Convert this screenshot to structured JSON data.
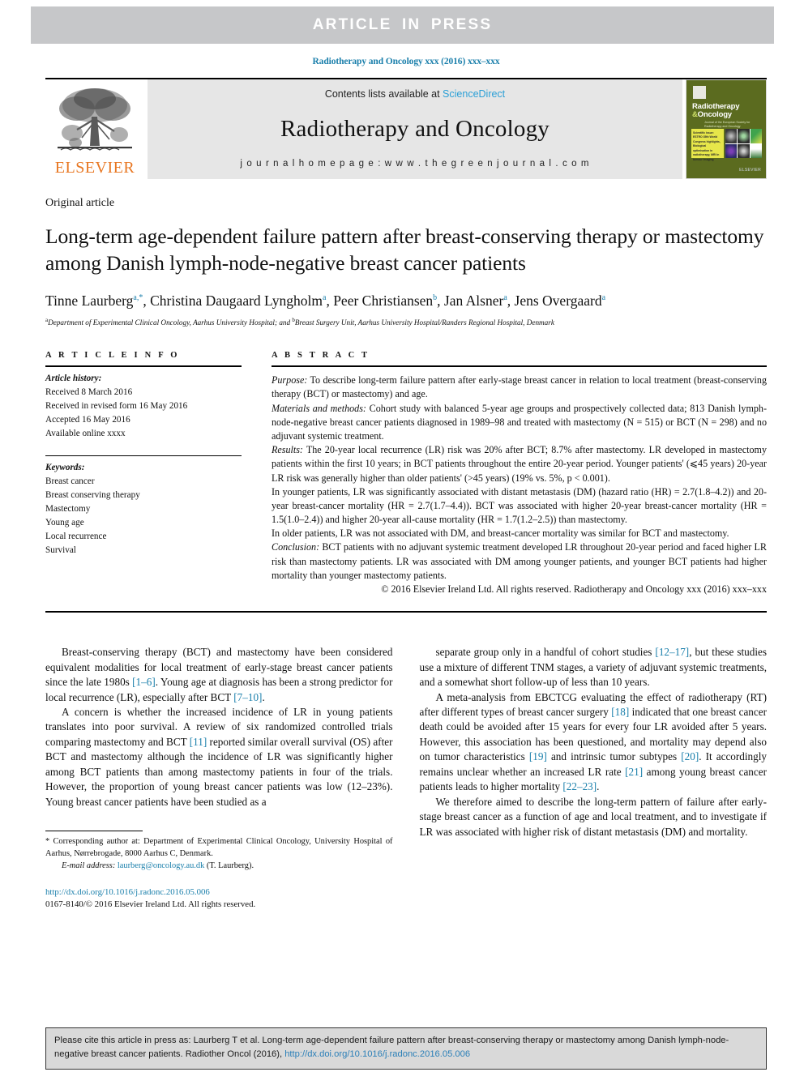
{
  "banner": {
    "text": "ARTICLE  IN  PRESS"
  },
  "journal_ref_top": "Radiotherapy and Oncology xxx (2016) xxx–xxx",
  "masthead": {
    "contents_prefix": "Contents lists available at ",
    "sciencedirect": "ScienceDirect",
    "journal_title": "Radiotherapy and Oncology",
    "homepage": "j o u r n a l   h o m e p a g e :   w w w . t h e g r e e n j o u r n a l . c o m",
    "publisher_word": "ELSEVIER",
    "cover": {
      "title_line1": "Radiotherapy",
      "title_amp": "&",
      "title_line2": "Oncology",
      "subtitle": "Journal of the European Society for Radiotherapy and Oncology",
      "yellow_note": "Scientific issue: ESTRO 35th World Congress highlights, Biological optimisation in radiotherapy, MRI in tumour imaging",
      "logo": "ELSEVIER"
    }
  },
  "article": {
    "type": "Original article",
    "title": "Long-term age-dependent failure pattern after breast-conserving therapy or mastectomy among Danish lymph-node-negative breast cancer patients",
    "authors": [
      {
        "name": "Tinne Laurberg",
        "sup": "a,*"
      },
      {
        "name": "Christina Daugaard Lyngholm",
        "sup": "a"
      },
      {
        "name": "Peer Christiansen",
        "sup": "b"
      },
      {
        "name": "Jan Alsner",
        "sup": "a"
      },
      {
        "name": "Jens Overgaard",
        "sup": "a"
      }
    ],
    "affiliation_a": "Department of Experimental Clinical Oncology, Aarhus University Hospital; and ",
    "affiliation_b": "Breast Surgery Unit, Aarhus University Hospital/Randers Regional Hospital, Denmark"
  },
  "info": {
    "heading": "A R T I C L E   I N F O",
    "history_label": "Article history:",
    "history": [
      "Received 8 March 2016",
      "Received in revised form 16 May 2016",
      "Accepted 16 May 2016",
      "Available online xxxx"
    ],
    "keywords_label": "Keywords:",
    "keywords": [
      "Breast cancer",
      "Breast conserving therapy",
      "Mastectomy",
      "Young age",
      "Local recurrence",
      "Survival"
    ]
  },
  "abstract": {
    "heading": "A B S T R A C T",
    "purpose_label": "Purpose:",
    "purpose_text": " To describe long-term failure pattern after early-stage breast cancer in relation to local treatment (breast-conserving therapy (BCT) or mastectomy) and age.",
    "methods_label": "Materials and methods:",
    "methods_text": " Cohort study with balanced 5-year age groups and prospectively collected data; 813 Danish lymph-node-negative breast cancer patients diagnosed in 1989–98 and treated with mastectomy (N = 515) or BCT (N = 298) and no adjuvant systemic treatment.",
    "results_label": "Results:",
    "results_text": " The 20-year local recurrence (LR) risk was 20% after BCT; 8.7% after mastectomy. LR developed in mastectomy patients within the first 10 years; in BCT patients throughout the entire 20-year period. Younger patients' (⩽45 years) 20-year LR risk was generally higher than older patients' (>45 years) (19% vs. 5%, p < 0.001).",
    "para_younger": "In younger patients, LR was significantly associated with distant metastasis (DM) (hazard ratio (HR) = 2.7(1.8–4.2)) and 20-year breast-cancer mortality (HR = 2.7(1.7–4.4)). BCT was associated with higher 20-year breast-cancer mortality (HR = 1.5(1.0–2.4)) and higher 20-year all-cause mortality (HR = 1.7(1.2–2.5)) than mastectomy.",
    "para_older": "In older patients, LR was not associated with DM, and breast-cancer mortality was similar for BCT and mastectomy.",
    "conclusion_label": "Conclusion:",
    "conclusion_text": " BCT patients with no adjuvant systemic treatment developed LR throughout 20-year period and faced higher LR risk than mastectomy patients. LR was associated with DM among younger patients, and younger BCT patients had higher mortality than younger mastectomy patients.",
    "copyright": "© 2016 Elsevier Ireland Ltd. All rights reserved. Radiotherapy and Oncology xxx (2016) xxx–xxx"
  },
  "body": {
    "left": {
      "p1_a": "Breast-conserving therapy (BCT) and mastectomy have been considered equivalent modalities for local treatment of early-stage breast cancer patients since the late 1980s ",
      "p1_ref1": "[1–6]",
      "p1_b": ". Young age at diagnosis has been a strong predictor for local recurrence (LR), especially after BCT ",
      "p1_ref2": "[7–10]",
      "p1_c": ".",
      "p2_a": "A concern is whether the increased incidence of LR in young patients translates into poor survival. A review of six randomized controlled trials comparing mastectomy and BCT ",
      "p2_ref1": "[11]",
      "p2_b": " reported similar overall survival (OS) after BCT and mastectomy although the incidence of LR was significantly higher among BCT patients than among mastectomy patients in four of the trials. However, the proportion of young breast cancer patients was low (12–23%). Young breast cancer patients have been studied as a"
    },
    "right": {
      "p1_a": "separate group only in a handful of cohort studies ",
      "p1_ref1": "[12–17]",
      "p1_b": ", but these studies use a mixture of different TNM stages, a variety of adjuvant systemic treatments, and a somewhat short follow-up of less than 10 years.",
      "p2_a": "A meta-analysis from EBCTCG evaluating the effect of radiotherapy (RT) after different types of breast cancer surgery ",
      "p2_ref1": "[18]",
      "p2_b": " indicated that one breast cancer death could be avoided after 15 years for every four LR avoided after 5 years. However, this association has been questioned, and mortality may depend also on tumor characteristics ",
      "p2_ref2": "[19]",
      "p2_c": " and intrinsic tumor subtypes ",
      "p2_ref3": "[20]",
      "p2_d": ". It accordingly remains unclear whether an increased LR rate ",
      "p2_ref4": "[21]",
      "p2_e": " among young breast cancer patients leads to higher mortality ",
      "p2_ref5": "[22–23]",
      "p2_f": ".",
      "p3": "We therefore aimed to describe the long-term pattern of failure after early-stage breast cancer as a function of age and local treatment, and to investigate if LR was associated with higher risk of distant metastasis (DM) and mortality."
    }
  },
  "footnote": {
    "corresponding": "* Corresponding author at: Department of Experimental Clinical Oncology, University Hospital of Aarhus, Nørrebrogade, 8000 Aarhus C, Denmark.",
    "email_label": "E-mail address:",
    "email": "laurberg@oncology.au.dk",
    "email_suffix": " (T. Laurberg)."
  },
  "issn": {
    "doi": "http://dx.doi.org/10.1016/j.radonc.2016.05.006",
    "line": "0167-8140/© 2016 Elsevier Ireland Ltd. All rights reserved."
  },
  "cite_box": {
    "text_a": "Please cite this article in press as: Laurberg T et al. Long-term age-dependent failure pattern after breast-conserving therapy or mastectomy among Danish lymph-node-negative breast cancer patients. Radiother Oncol (2016), ",
    "doi": "http://dx.doi.org/10.1016/j.radonc.2016.05.006"
  },
  "colors": {
    "link": "#1a7fab",
    "banner_bg": "#c6c7c9",
    "masthead_bg": "#e6e6e6",
    "elsevier_orange": "#e87722",
    "cover_green": "#5b6b1f",
    "cite_bg": "#d9d9d9"
  }
}
